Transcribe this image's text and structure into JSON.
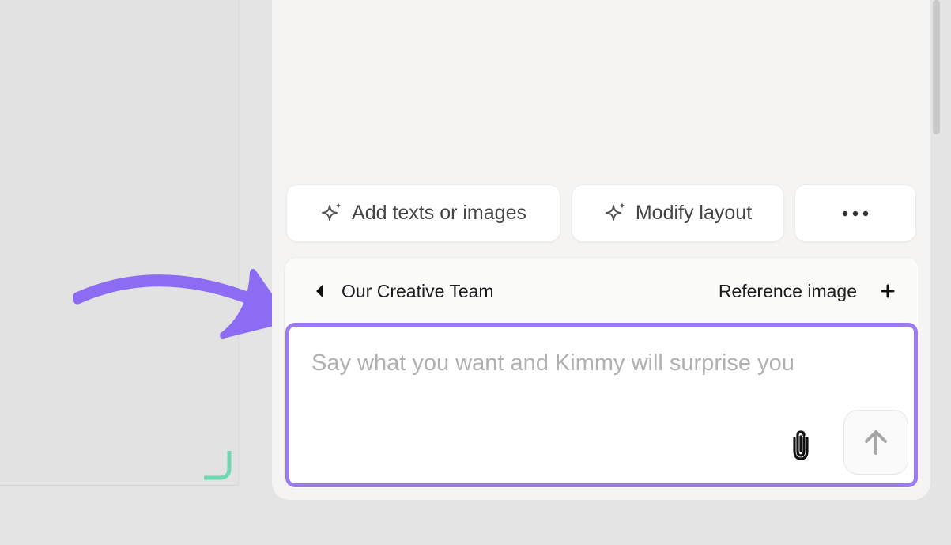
{
  "colors": {
    "accent": "#9b7cf0",
    "annotation_arrow": "#8b6cf2",
    "resize_handle": "#6fd8b0"
  },
  "actions": {
    "add_texts_label": "Add texts or images",
    "modify_layout_label": "Modify layout",
    "more_icon": "ellipsis-icon"
  },
  "composer": {
    "team_label": "Our Creative Team",
    "reference_label": "Reference image",
    "placeholder": "Say what you want and Kimmy will surprise you",
    "value": ""
  },
  "icons": {
    "sparkle": "sparkle-icon",
    "caret": "caret-left-icon",
    "plus": "plus-icon",
    "attach": "paperclip-icon",
    "send": "arrow-up-icon"
  }
}
